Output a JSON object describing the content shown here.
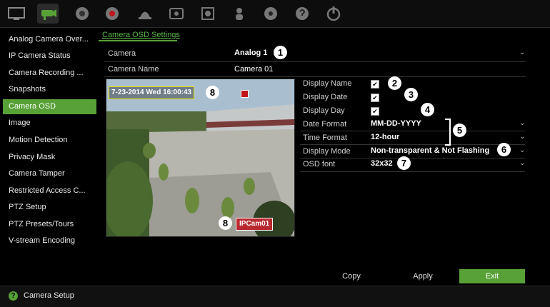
{
  "toolbar": {
    "icons": [
      "monitor-icon",
      "camera-icon",
      "network-icon",
      "record-icon",
      "alarm-icon",
      "hdd-icon",
      "archive-icon",
      "user-icon",
      "settings-icon",
      "help-icon",
      "power-icon"
    ],
    "active_index": 1
  },
  "sidebar": {
    "items": [
      {
        "label": "Analog Camera Over..."
      },
      {
        "label": "IP Camera Status"
      },
      {
        "label": "Camera Recording ..."
      },
      {
        "label": "Snapshots"
      },
      {
        "label": "Camera OSD"
      },
      {
        "label": "Image"
      },
      {
        "label": "Motion Detection"
      },
      {
        "label": "Privacy Mask"
      },
      {
        "label": "Camera Tamper"
      },
      {
        "label": "Restricted Access C..."
      },
      {
        "label": "PTZ Setup"
      },
      {
        "label": "PTZ Presets/Tours"
      },
      {
        "label": "V-stream Encoding"
      }
    ],
    "active_index": 4
  },
  "page": {
    "title": "Camera OSD Settings",
    "camera_label": "Camera",
    "camera_value": "Analog 1",
    "camera_name_label": "Camera Name",
    "camera_name_value": "Camera 01"
  },
  "preview": {
    "date_overlay": "7-23-2014 Wed 16:00:43",
    "name_overlay": "IPCam01"
  },
  "settings": {
    "display_name_label": "Display Name",
    "display_name_checked": true,
    "display_date_label": "Display Date",
    "display_date_checked": true,
    "display_day_label": "Display Day",
    "display_day_checked": true,
    "date_format_label": "Date Format",
    "date_format_value": "MM-DD-YYYY",
    "time_format_label": "Time Format",
    "time_format_value": "12-hour",
    "display_mode_label": "Display Mode",
    "display_mode_value": "Non-transparent & Not Flashing",
    "osd_font_label": "OSD font",
    "osd_font_value": "32x32"
  },
  "callouts": [
    "1",
    "2",
    "3",
    "4",
    "5",
    "6",
    "7",
    "8",
    "8"
  ],
  "buttons": {
    "copy": "Copy",
    "apply": "Apply",
    "exit": "Exit"
  },
  "status": {
    "text": "Camera Setup"
  },
  "colors": {
    "accent": "#58a136",
    "title": "#58b545"
  }
}
